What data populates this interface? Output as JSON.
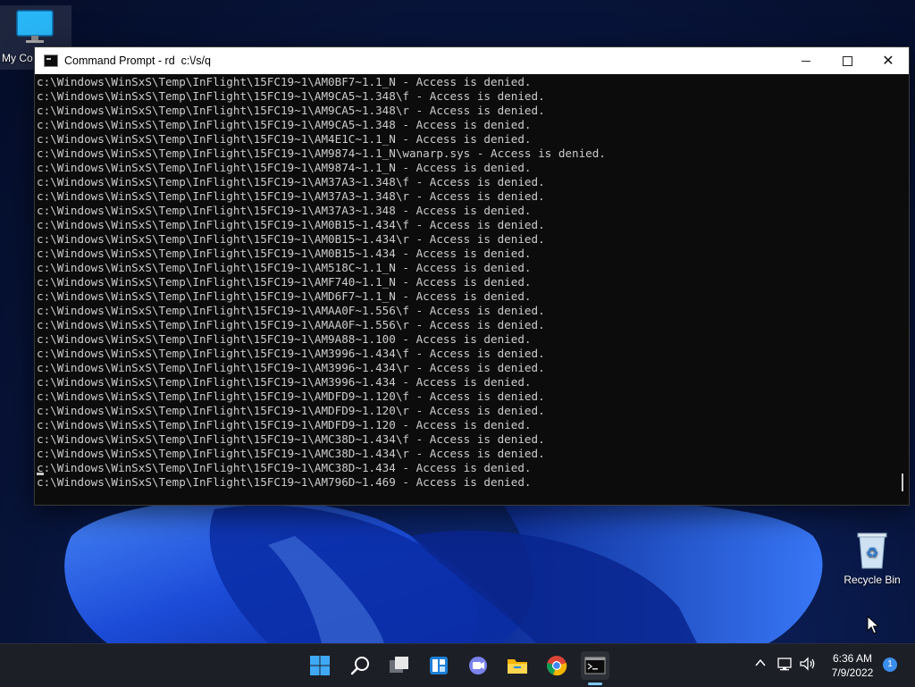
{
  "desktop": {
    "icons": [
      {
        "label": "My Co"
      },
      {
        "label": "Recycle Bin"
      }
    ]
  },
  "window": {
    "title": "Command Prompt - rd  c:\\/s/q",
    "controls": {
      "minimize": "minimize",
      "maximize": "maximize",
      "close": "close"
    }
  },
  "console": {
    "lines": [
      "c:\\Windows\\WinSxS\\Temp\\InFlight\\15FC19~1\\AM0BF7~1.1_N - Access is denied.",
      "c:\\Windows\\WinSxS\\Temp\\InFlight\\15FC19~1\\AM9CA5~1.348\\f - Access is denied.",
      "c:\\Windows\\WinSxS\\Temp\\InFlight\\15FC19~1\\AM9CA5~1.348\\r - Access is denied.",
      "c:\\Windows\\WinSxS\\Temp\\InFlight\\15FC19~1\\AM9CA5~1.348 - Access is denied.",
      "c:\\Windows\\WinSxS\\Temp\\InFlight\\15FC19~1\\AM4E1C~1.1_N - Access is denied.",
      "c:\\Windows\\WinSxS\\Temp\\InFlight\\15FC19~1\\AM9874~1.1_N\\wanarp.sys - Access is denied.",
      "c:\\Windows\\WinSxS\\Temp\\InFlight\\15FC19~1\\AM9874~1.1_N - Access is denied.",
      "c:\\Windows\\WinSxS\\Temp\\InFlight\\15FC19~1\\AM37A3~1.348\\f - Access is denied.",
      "c:\\Windows\\WinSxS\\Temp\\InFlight\\15FC19~1\\AM37A3~1.348\\r - Access is denied.",
      "c:\\Windows\\WinSxS\\Temp\\InFlight\\15FC19~1\\AM37A3~1.348 - Access is denied.",
      "c:\\Windows\\WinSxS\\Temp\\InFlight\\15FC19~1\\AM0B15~1.434\\f - Access is denied.",
      "c:\\Windows\\WinSxS\\Temp\\InFlight\\15FC19~1\\AM0B15~1.434\\r - Access is denied.",
      "c:\\Windows\\WinSxS\\Temp\\InFlight\\15FC19~1\\AM0B15~1.434 - Access is denied.",
      "c:\\Windows\\WinSxS\\Temp\\InFlight\\15FC19~1\\AM518C~1.1_N - Access is denied.",
      "c:\\Windows\\WinSxS\\Temp\\InFlight\\15FC19~1\\AMF740~1.1_N - Access is denied.",
      "c:\\Windows\\WinSxS\\Temp\\InFlight\\15FC19~1\\AMD6F7~1.1_N - Access is denied.",
      "c:\\Windows\\WinSxS\\Temp\\InFlight\\15FC19~1\\AMAA0F~1.556\\f - Access is denied.",
      "c:\\Windows\\WinSxS\\Temp\\InFlight\\15FC19~1\\AMAA0F~1.556\\r - Access is denied.",
      "c:\\Windows\\WinSxS\\Temp\\InFlight\\15FC19~1\\AM9A88~1.100 - Access is denied.",
      "c:\\Windows\\WinSxS\\Temp\\InFlight\\15FC19~1\\AM3996~1.434\\f - Access is denied.",
      "c:\\Windows\\WinSxS\\Temp\\InFlight\\15FC19~1\\AM3996~1.434\\r - Access is denied.",
      "c:\\Windows\\WinSxS\\Temp\\InFlight\\15FC19~1\\AM3996~1.434 - Access is denied.",
      "c:\\Windows\\WinSxS\\Temp\\InFlight\\15FC19~1\\AMDFD9~1.120\\f - Access is denied.",
      "c:\\Windows\\WinSxS\\Temp\\InFlight\\15FC19~1\\AMDFD9~1.120\\r - Access is denied.",
      "c:\\Windows\\WinSxS\\Temp\\InFlight\\15FC19~1\\AMDFD9~1.120 - Access is denied.",
      "c:\\Windows\\WinSxS\\Temp\\InFlight\\15FC19~1\\AMC38D~1.434\\f - Access is denied.",
      "c:\\Windows\\WinSxS\\Temp\\InFlight\\15FC19~1\\AMC38D~1.434\\r - Access is denied.",
      "c:\\Windows\\WinSxS\\Temp\\InFlight\\15FC19~1\\AMC38D~1.434 - Access is denied.",
      "c:\\Windows\\WinSxS\\Temp\\InFlight\\15FC19~1\\AM796D~1.469 - Access is denied."
    ]
  },
  "taskbar": {
    "apps": [
      {
        "name": "start-button",
        "icon": "windows-logo-icon"
      },
      {
        "name": "search-button",
        "icon": "search-icon"
      },
      {
        "name": "task-view-button",
        "icon": "task-view-icon"
      },
      {
        "name": "widgets-button",
        "icon": "widgets-icon"
      },
      {
        "name": "chat-button",
        "icon": "teams-chat-icon"
      },
      {
        "name": "file-explorer-button",
        "icon": "folder-icon"
      },
      {
        "name": "chrome-button",
        "icon": "chrome-icon"
      },
      {
        "name": "command-prompt-button",
        "icon": "terminal-icon"
      }
    ],
    "tray": {
      "time": "6:36 AM",
      "date": "7/9/2022",
      "notification_count": "1"
    }
  },
  "colors": {
    "console_bg": "#0c0c0c",
    "console_text": "#cccccc",
    "taskbar_bg": "#1c1f26",
    "accent": "#3b8eea"
  }
}
